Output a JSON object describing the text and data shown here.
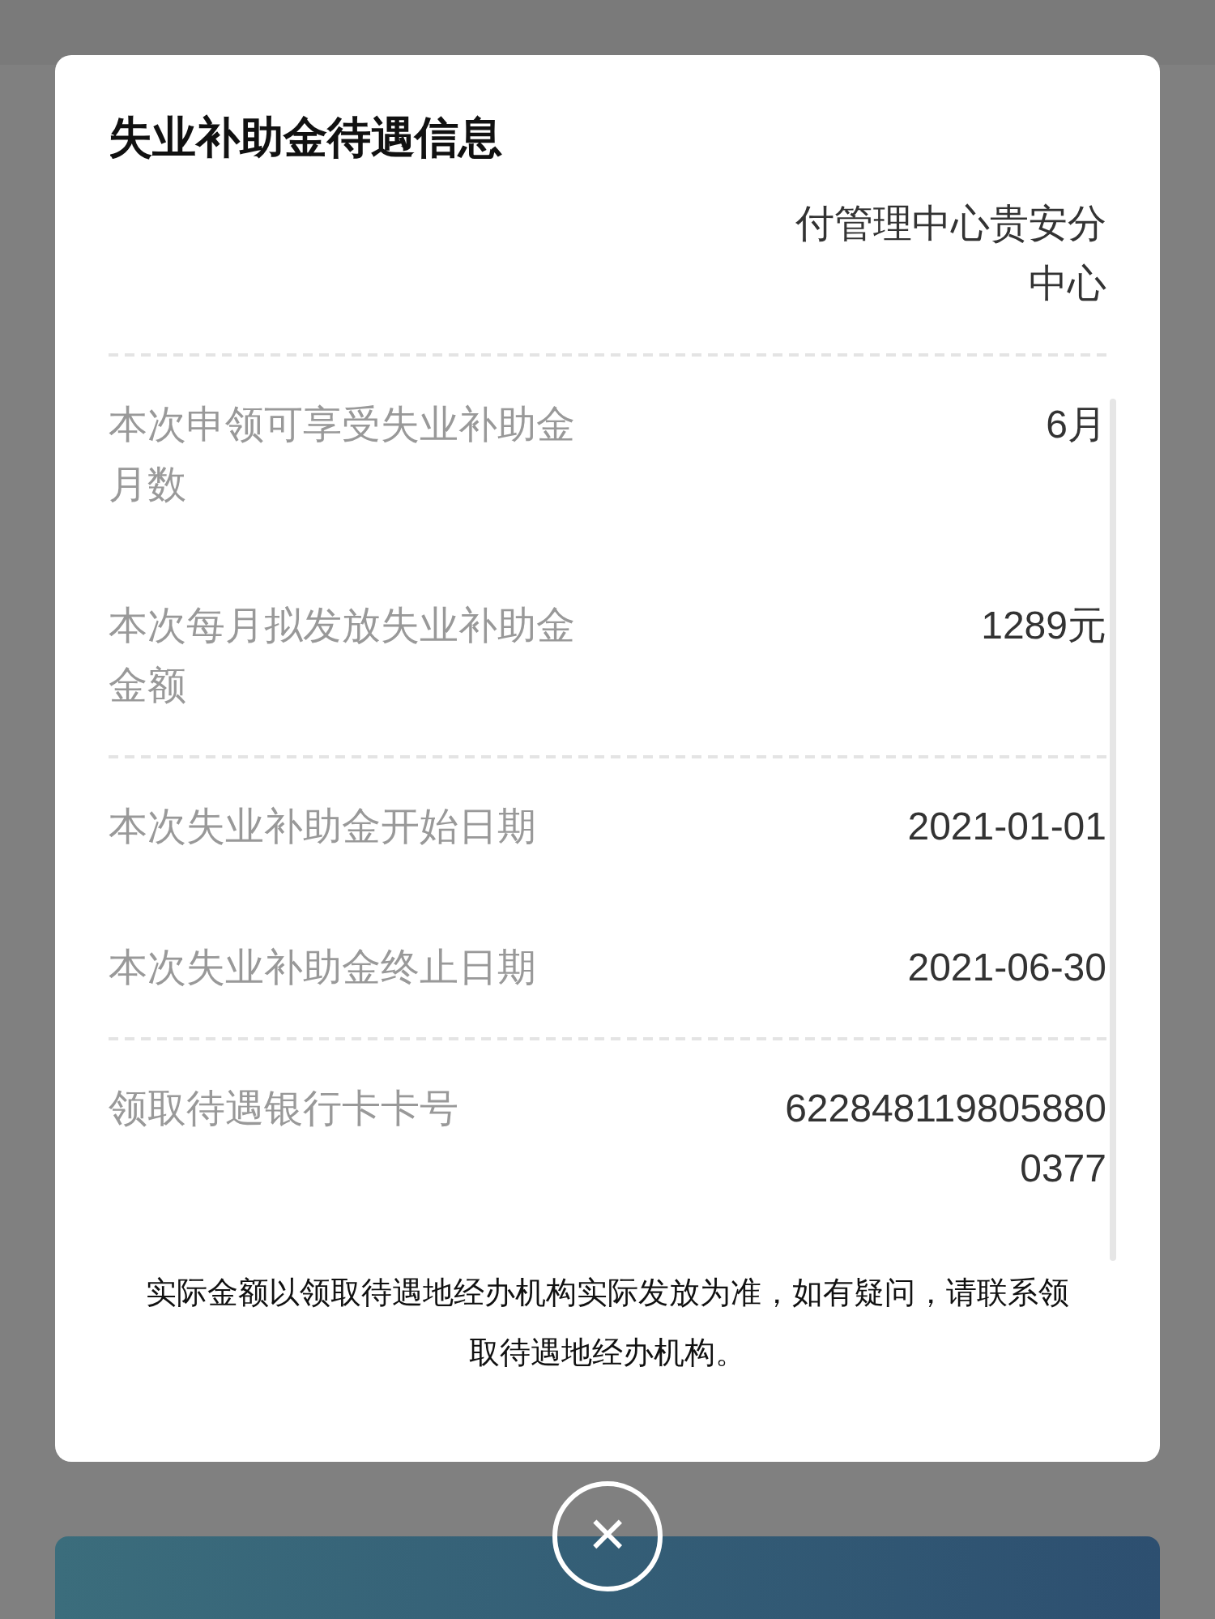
{
  "dialog": {
    "title": "失业补助金待遇信息",
    "sections": [
      [
        {
          "value": "付管理中心贵安分中心"
        }
      ],
      [
        {
          "label": "本次申领可享受失业补助金月数",
          "value": "6月"
        },
        {
          "label": "本次每月拟发放失业补助金金额",
          "value": "1289元"
        }
      ],
      [
        {
          "label": "本次失业补助金开始日期",
          "value": "2021-01-01"
        },
        {
          "label": "本次失业补助金终止日期",
          "value": "2021-06-30"
        }
      ],
      [
        {
          "label": "领取待遇银行卡卡号",
          "value": "6228481198058800377"
        }
      ]
    ],
    "note": "实际金额以领取待遇地经办机构实际发放为准，如有疑问，请联系领取待遇地经办机构。"
  },
  "close_button": {
    "icon": "×"
  }
}
